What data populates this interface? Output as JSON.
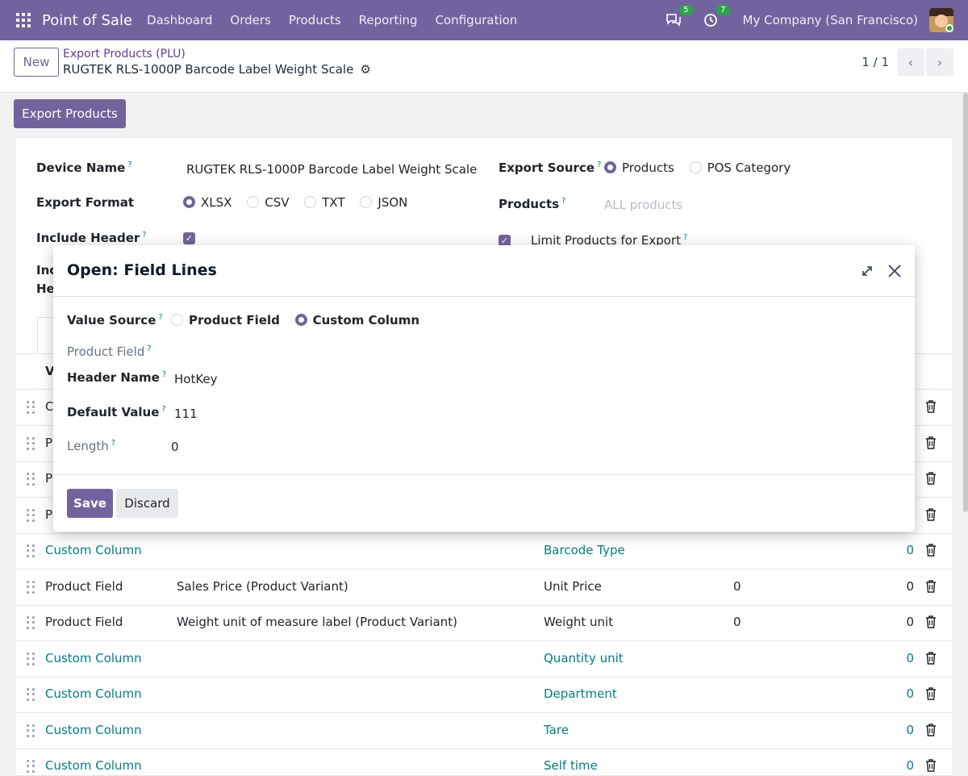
{
  "navbar": {
    "app_name": "Point of Sale",
    "menu": [
      "Dashboard",
      "Orders",
      "Products",
      "Reporting",
      "Configuration"
    ],
    "messages_count": "5",
    "activities_count": "7",
    "company": "My Company (San Francisco)"
  },
  "control_panel": {
    "new_label": "New",
    "breadcrumb_parent": "Export Products (PLU)",
    "breadcrumb_current": "RUGTEK RLS-1000P Barcode Label Weight Scale",
    "pager": "1 / 1"
  },
  "form": {
    "export_button": "Export Products",
    "device_name_label": "Device Name",
    "device_name_value": "RUGTEK RLS-1000P Barcode Label Weight Scale",
    "export_format_label": "Export Format",
    "export_format_options": [
      "XLSX",
      "CSV",
      "TXT",
      "JSON"
    ],
    "export_format_selected": "XLSX",
    "include_header_label": "Include Header",
    "export_source_label": "Export Source",
    "export_source_options": [
      "Products",
      "POS Category"
    ],
    "export_source_selected": "Products",
    "products_label": "Products",
    "products_placeholder": "ALL products",
    "limit_products_label": "Limit Products for Export",
    "partial_label_1": "Inc",
    "partial_label_2": "He",
    "list_header_partial": "V"
  },
  "list_rows": [
    {
      "source": "C",
      "field": "",
      "header": "",
      "default": "",
      "length": ""
    },
    {
      "source": "P",
      "field": "",
      "header": "",
      "default": "",
      "length": ""
    },
    {
      "source": "P",
      "field": "",
      "header": "",
      "default": "",
      "length": ""
    },
    {
      "source": "P",
      "field": "",
      "header": "",
      "default": "",
      "length": ""
    },
    {
      "source": "Custom Column",
      "field": "",
      "header": "Barcode Type",
      "default": "",
      "length": "0"
    },
    {
      "source": "Product Field",
      "field": "Sales Price (Product Variant)",
      "header": "Unit Price",
      "default": "0",
      "length": "0"
    },
    {
      "source": "Product Field",
      "field": "Weight unit of measure label (Product Variant)",
      "header": "Weight unit",
      "default": "0",
      "length": "0"
    },
    {
      "source": "Custom Column",
      "field": "",
      "header": "Quantity unit",
      "default": "",
      "length": "0"
    },
    {
      "source": "Custom Column",
      "field": "",
      "header": "Department",
      "default": "",
      "length": "0"
    },
    {
      "source": "Custom Column",
      "field": "",
      "header": "Tare",
      "default": "",
      "length": "0"
    },
    {
      "source": "Custom Column",
      "field": "",
      "header": "Self time",
      "default": "",
      "length": "0"
    }
  ],
  "modal": {
    "title": "Open: Field Lines",
    "value_source_label": "Value Source",
    "value_source_options": [
      "Product Field",
      "Custom Column"
    ],
    "value_source_selected": "Custom Column",
    "product_field_label": "Product Field",
    "header_name_label": "Header Name",
    "header_name_value": "HotKey",
    "default_value_label": "Default Value",
    "default_value_value": "111",
    "length_label": "Length",
    "length_value": "0",
    "save_label": "Save",
    "discard_label": "Discard"
  },
  "colors": {
    "brand": "#71639e",
    "link": "#017e84",
    "badge": "#28a745"
  }
}
